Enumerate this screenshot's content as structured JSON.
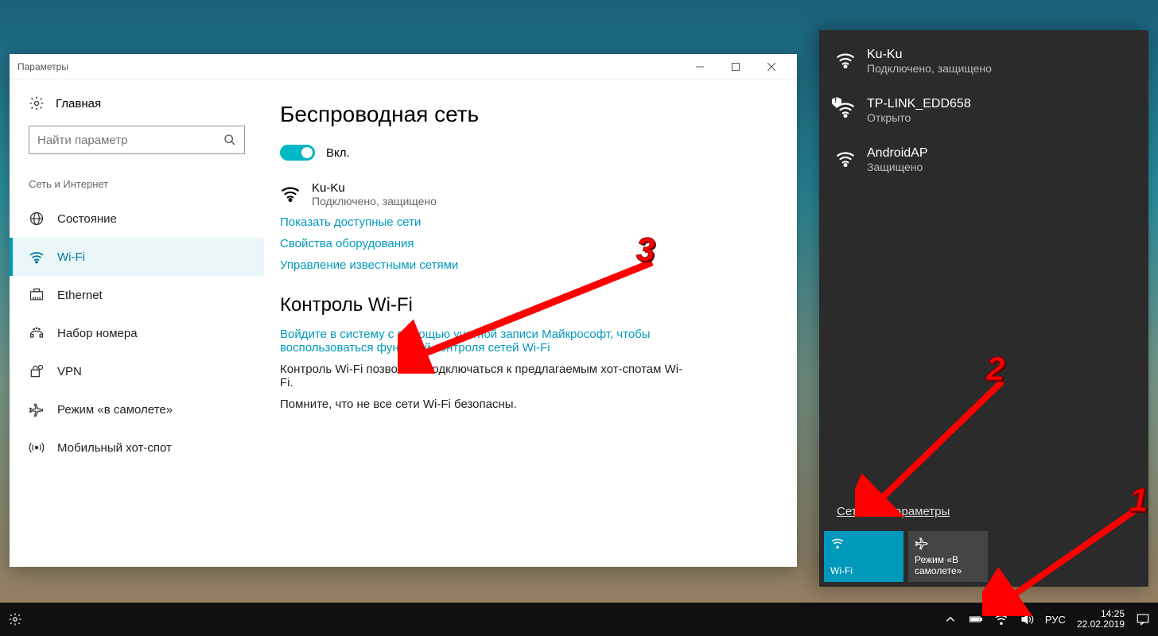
{
  "settings_window": {
    "title": "Параметры",
    "home": "Главная",
    "search_placeholder": "Найти параметр",
    "category": "Сеть и Интернет",
    "nav": [
      {
        "id": "status",
        "label": "Состояние"
      },
      {
        "id": "wifi",
        "label": "Wi-Fi",
        "active": true
      },
      {
        "id": "ethernet",
        "label": "Ethernet"
      },
      {
        "id": "dialup",
        "label": "Набор номера"
      },
      {
        "id": "vpn",
        "label": "VPN"
      },
      {
        "id": "airplane",
        "label": "Режим «в самолете»"
      },
      {
        "id": "hotspot",
        "label": "Мобильный хот-спот"
      }
    ],
    "content": {
      "h1": "Беспроводная сеть",
      "toggle_label": "Вкл.",
      "current": {
        "name": "Ku-Ku",
        "status": "Подключено, защищено"
      },
      "link_available": "Показать доступные сети",
      "link_hwprops": "Свойства оборудования",
      "link_known": "Управление известными сетями",
      "h2": "Контроль Wi-Fi",
      "link_signin": "Войдите в систему с помощью учетной записи Майкрософт, чтобы воспользоваться функцией контроля сетей Wi-Fi",
      "para1": "Контроль Wi-Fi позволяет подключаться к предлагаемым хот-спотам Wi-Fi.",
      "para2": "Помните, что не все сети Wi-Fi безопасны."
    }
  },
  "flyout": {
    "networks": [
      {
        "name": "Ku-Ku",
        "sub": "Подключено, защищено",
        "secure": true
      },
      {
        "name": "TP-LINK_EDD658",
        "sub": "Открыто",
        "open": true
      },
      {
        "name": "AndroidAP",
        "sub": "Защищено",
        "secure": true
      }
    ],
    "settings_link": "Сетевые параметры",
    "tiles": {
      "wifi": {
        "label": "Wi-Fi"
      },
      "airplane": {
        "label": "Режим «В самолете»"
      }
    }
  },
  "taskbar": {
    "lang": "РУС",
    "time": "14:25",
    "date": "22.02.2019"
  },
  "annotations": {
    "n1": "1",
    "n2": "2",
    "n3": "3"
  }
}
